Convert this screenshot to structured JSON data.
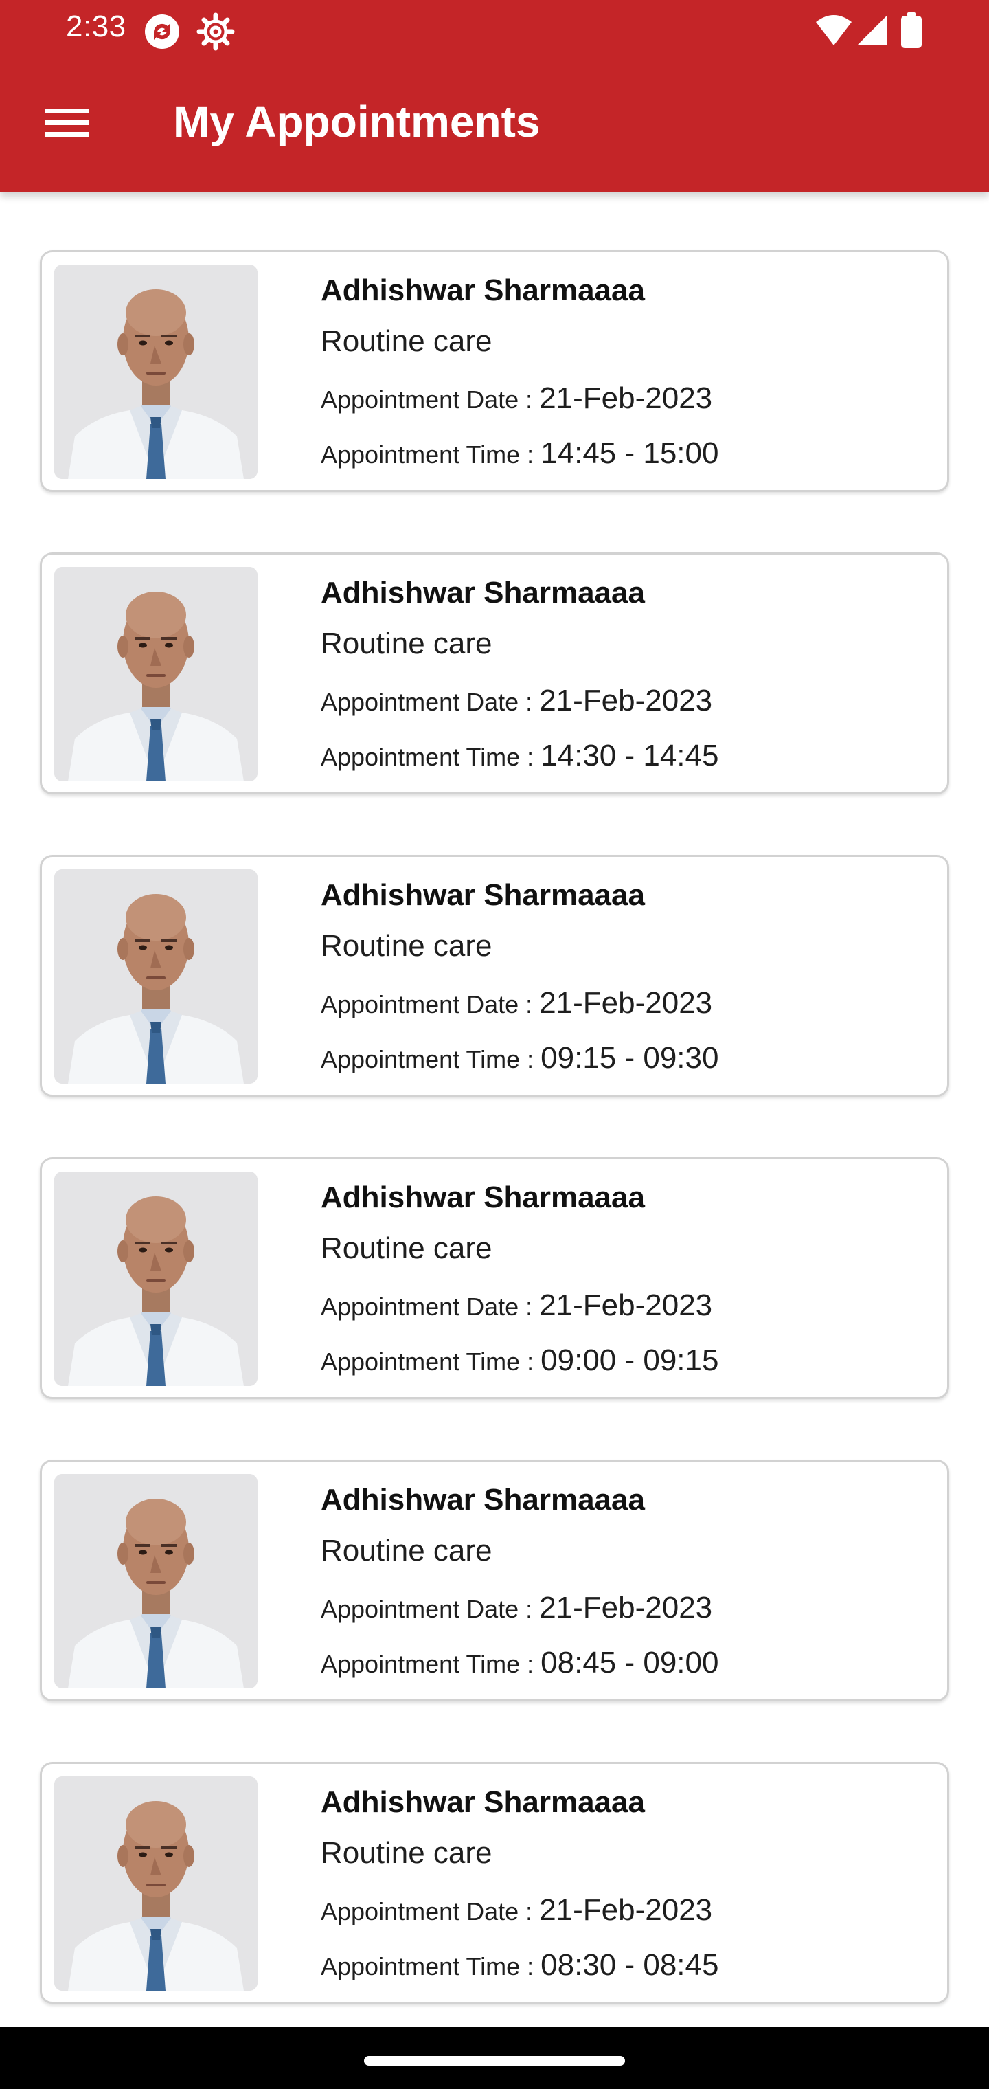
{
  "status_bar": {
    "time": "2:33",
    "icons": [
      "sync-badge-icon",
      "settings-gear-icon",
      "wifi-icon",
      "signal-icon",
      "battery-icon"
    ]
  },
  "toolbar": {
    "title": "My Appointments",
    "menu_icon": "hamburger-menu-icon"
  },
  "colors": {
    "primary": "#c42528",
    "card_border": "#d2d2d2"
  },
  "appointments": [
    {
      "doctor": "Adhishwar Sharmaaaa",
      "service": "Routine care",
      "date_label": "Appointment Date : ",
      "date": "21-Feb-2023",
      "time_label": "Appointment Time : ",
      "time": "14:45 - 15:00"
    },
    {
      "doctor": "Adhishwar Sharmaaaa",
      "service": "Routine care",
      "date_label": "Appointment Date : ",
      "date": "21-Feb-2023",
      "time_label": "Appointment Time : ",
      "time": "14:30 - 14:45"
    },
    {
      "doctor": "Adhishwar Sharmaaaa",
      "service": "Routine care",
      "date_label": "Appointment Date : ",
      "date": "21-Feb-2023",
      "time_label": "Appointment Time : ",
      "time": "09:15 - 09:30"
    },
    {
      "doctor": "Adhishwar Sharmaaaa",
      "service": "Routine care",
      "date_label": "Appointment Date : ",
      "date": "21-Feb-2023",
      "time_label": "Appointment Time : ",
      "time": "09:00 - 09:15"
    },
    {
      "doctor": "Adhishwar Sharmaaaa",
      "service": "Routine care",
      "date_label": "Appointment Date : ",
      "date": "21-Feb-2023",
      "time_label": "Appointment Time : ",
      "time": "08:45 - 09:00"
    },
    {
      "doctor": "Adhishwar Sharmaaaa",
      "service": "Routine care",
      "date_label": "Appointment Date : ",
      "date": "21-Feb-2023",
      "time_label": "Appointment Time : ",
      "time": "08:30 - 08:45"
    }
  ]
}
